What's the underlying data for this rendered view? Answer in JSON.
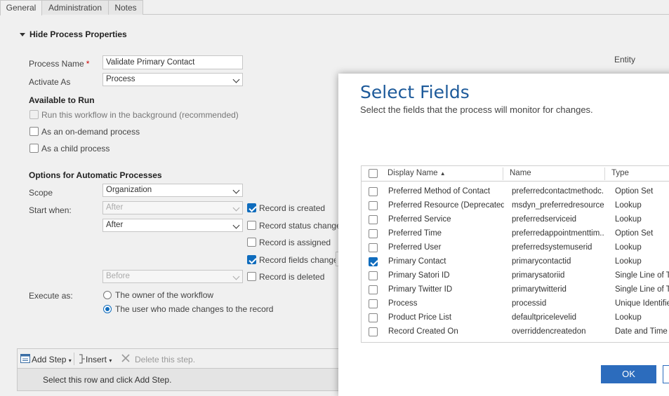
{
  "tabs": [
    "General",
    "Administration",
    "Notes"
  ],
  "section_title": "Hide Process Properties",
  "form": {
    "process_name_label": "Process Name",
    "required_mark": "*",
    "process_name_value": "Validate Primary Contact",
    "activate_as_label": "Activate As",
    "activate_as_value": "Process",
    "entity_label": "Entity",
    "available_title": "Available to Run",
    "run_background": "Run this workflow in the background (recommended)",
    "on_demand": "As an on-demand process",
    "child_process": "As a child process",
    "options_title": "Options for Automatic Processes",
    "scope_label": "Scope",
    "scope_value": "Organization",
    "start_when_label": "Start when:",
    "start_select_1": "After",
    "start_select_2": "After",
    "start_select_3": "Before",
    "record_created": "Record is created",
    "record_status": "Record status changes",
    "record_assigned": "Record is assigned",
    "record_fields": "Record fields change",
    "record_deleted": "Record is deleted",
    "execute_as_label": "Execute as:",
    "owner_option": "The owner of the workflow",
    "user_option": "The user who made changes to the record"
  },
  "steps": {
    "add_step": "Add Step",
    "insert": "Insert",
    "delete": "Delete this step.",
    "hint": "Select this row and click Add Step."
  },
  "dialog": {
    "title": "Select Fields",
    "subtitle": "Select the fields that the process will monitor for changes.",
    "columns": [
      "Display Name",
      "Name",
      "Type"
    ],
    "sort_indicator": "▲",
    "rows": [
      {
        "display": "Preferred Method of Contact",
        "name": "preferredcontactmethodc...",
        "type": "Option Set",
        "checked": false
      },
      {
        "display": "Preferred Resource (Deprecated)",
        "name": "msdyn_preferredresource",
        "type": "Lookup",
        "checked": false
      },
      {
        "display": "Preferred Service",
        "name": "preferredserviceid",
        "type": "Lookup",
        "checked": false
      },
      {
        "display": "Preferred Time",
        "name": "preferredappointmenttim...",
        "type": "Option Set",
        "checked": false
      },
      {
        "display": "Preferred User",
        "name": "preferredsystemuserid",
        "type": "Lookup",
        "checked": false
      },
      {
        "display": "Primary Contact",
        "name": "primarycontactid",
        "type": "Lookup",
        "checked": true
      },
      {
        "display": "Primary Satori ID",
        "name": "primarysatoriid",
        "type": "Single Line of Te",
        "checked": false
      },
      {
        "display": "Primary Twitter ID",
        "name": "primarytwitterid",
        "type": "Single Line of Te",
        "checked": false
      },
      {
        "display": "Process",
        "name": "processid",
        "type": "Unique Identifie",
        "checked": false
      },
      {
        "display": "Product Price List",
        "name": "defaultpricelevelid",
        "type": "Lookup",
        "checked": false
      },
      {
        "display": "Record Created On",
        "name": "overriddencreatedon",
        "type": "Date and Time",
        "checked": false
      }
    ],
    "ok_label": "OK"
  },
  "colors": {
    "accent": "#0f6cbd",
    "title": "#1d5a9a",
    "ok_button": "#2c6cbd"
  }
}
